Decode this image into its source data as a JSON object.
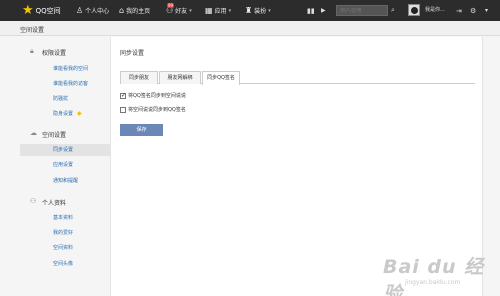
{
  "topbar": {
    "logo_text": "QQ空间",
    "nav": [
      {
        "label": "个人中心",
        "icon": "person-icon"
      },
      {
        "label": "我的主页",
        "icon": "home-icon"
      },
      {
        "label": "好友",
        "icon": "friends-icon",
        "badge": "99"
      },
      {
        "label": "应用",
        "icon": "apps-grid-icon"
      },
      {
        "label": "装扮",
        "icon": "shirt-icon"
      }
    ],
    "search_placeholder": "用户/应用",
    "username": "我是你..."
  },
  "subheader": {
    "title": "空间设置"
  },
  "sidebar": {
    "sections": [
      {
        "title": "权限设置",
        "icon": "lock-icon",
        "items": [
          "谁能看我的空间",
          "谁能看我的访客",
          "防骚扰",
          "隐身设置"
        ]
      },
      {
        "title": "空间设置",
        "icon": "cloud-icon",
        "items": [
          "同步设置",
          "应用设置",
          "通知和提醒"
        ]
      },
      {
        "title": "个人资料",
        "icon": "people-icon",
        "items": [
          "基本资料",
          "我的爱好",
          "空间资料",
          "空间头像"
        ]
      }
    ],
    "active_item": "同步设置"
  },
  "main": {
    "title": "同步设置",
    "tabs": [
      "同步朋友",
      "朋友网解绑",
      "同步QQ签名"
    ],
    "selected_tab": "同步QQ签名",
    "options": [
      {
        "label": "将QQ签名同步到空间说说",
        "checked": true
      },
      {
        "label": "将空间说说同步到QQ签名",
        "checked": false
      }
    ],
    "save_label": "保存"
  },
  "watermark": {
    "big": "Bai du 经验",
    "small": "jingyan.baidu.com"
  },
  "colors": {
    "topbar": "#2c2c2c",
    "accent": "#2a6fb0",
    "button": "#6b87b8",
    "logo_star": "#f5c400"
  }
}
